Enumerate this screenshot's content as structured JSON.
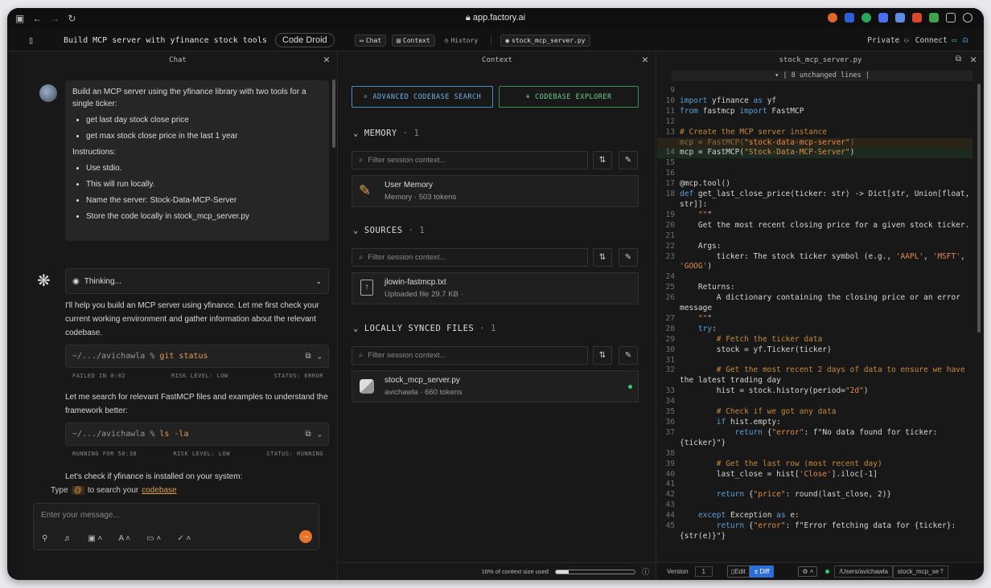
{
  "browser": {
    "url": "app.factory.ai"
  },
  "topbar": {
    "session_title": "Build MCP server with yfinance stock tools",
    "droid_label": "Code Droid",
    "tabs": [
      "Chat",
      "Context",
      "History"
    ],
    "file_tab": "stock_mcp_server.py",
    "private_label": "Private",
    "connect_label": "Connect"
  },
  "chat": {
    "title": "Chat",
    "user_message": {
      "intro": "Build an MCP server using the yfinance library with two tools for a single ticker:",
      "bullets1": [
        "get last day stock close price",
        "get max stock close price in the last 1 year"
      ],
      "instructions_label": "Instructions:",
      "bullets2": [
        "Use stdio.",
        "This will run locally.",
        "Name the server: Stock-Data-MCP-Server",
        "Store the code locally in stock_mcp_server.py"
      ]
    },
    "thinking_label": "Thinking...",
    "para1": "I'll help you build an MCP server using yfinance. Let me first check your current working environment and gather information about the relevant codebase.",
    "term1": {
      "path": "~/.../avichawla",
      "prompt": "%",
      "cmd": "git status",
      "meta": [
        "FAILED IN 0:02",
        "RISK LEVEL: LOW",
        "STATUS: ERROR"
      ]
    },
    "para2": "Let me search for relevant FastMCP files and examples to understand the framework better:",
    "term2": {
      "path": "~/.../avichawla",
      "prompt": "%",
      "cmd": "ls -la",
      "meta": [
        "RUNNING FOR 58:38",
        "RISK LEVEL: LOW",
        "STATUS: RUNNING"
      ]
    },
    "para3": "Let's check if yfinance is installed on your system:",
    "hint": {
      "prefix": "Type",
      "at": "@",
      "middle": "to search your",
      "link": "codebase"
    },
    "input_placeholder": "Enter your message..."
  },
  "context": {
    "title": "Context",
    "btn_search": "ADVANCED CODEBASE SEARCH",
    "btn_explorer": "CODEBASE EXPLORER",
    "filter_placeholder": "Filter session context...",
    "sections": [
      {
        "name": "MEMORY",
        "count": "1",
        "item": {
          "title": "User Memory",
          "sub": "Memory · 503 tokens"
        }
      },
      {
        "name": "SOURCES",
        "count": "1",
        "item": {
          "title": "jlowin-fastmcp.txt",
          "sub": "Uploaded file 29.7 KB ·"
        }
      },
      {
        "name": "LOCALLY SYNCED FILES",
        "count": "1",
        "item": {
          "title": "stock_mcp_server.py",
          "sub": "avichawla · 660 tokens"
        }
      }
    ],
    "usage": "16% of context size used",
    "usage_fraction": 0.16
  },
  "editor": {
    "title": "stock_mcp_server.py",
    "unchanged": "8 unchanged lines",
    "version_label": "Version",
    "version_value": "1",
    "edit_label": "Edit",
    "diff_label": "± Diff",
    "path": "/Users/avichawla",
    "file_chip": "stock_mcp_se"
  },
  "code_lines": [
    {
      "n": "9",
      "t": ""
    },
    {
      "n": "10",
      "t": "import yfinance as yf"
    },
    {
      "n": "11",
      "t": "from fastmcp import FastMCP"
    },
    {
      "n": "12",
      "t": ""
    },
    {
      "n": "13",
      "t": "# Create the MCP server instance"
    },
    {
      "n": "",
      "t": "mcp = FastMCP(\"stock-data-mcp-server\")"
    },
    {
      "n": "14",
      "t": "mcp = FastMCP(\"Stock-Data-MCP-Server\")"
    },
    {
      "n": "15",
      "t": ""
    },
    {
      "n": "16",
      "t": ""
    },
    {
      "n": "17",
      "t": "@mcp.tool()"
    },
    {
      "n": "18",
      "t": "def get_last_close_price(ticker: str) -> Dict[str, Union[float,"
    },
    {
      "n": "",
      "t": "str]]:"
    },
    {
      "n": "19",
      "t": "    \"\"\""
    },
    {
      "n": "20",
      "t": "    Get the most recent closing price for a given stock ticker."
    },
    {
      "n": "21",
      "t": ""
    },
    {
      "n": "22",
      "t": "    Args:"
    },
    {
      "n": "23",
      "t": "        ticker: The stock ticker symbol (e.g., 'AAPL', 'MSFT',"
    },
    {
      "n": "",
      "t": "'GOOG')"
    },
    {
      "n": "24",
      "t": ""
    },
    {
      "n": "25",
      "t": "    Returns:"
    },
    {
      "n": "26",
      "t": "        A dictionary containing the closing price or an error"
    },
    {
      "n": "",
      "t": "message"
    },
    {
      "n": "27",
      "t": "    \"\"\""
    },
    {
      "n": "28",
      "t": "    try:"
    },
    {
      "n": "29",
      "t": "        # Fetch the ticker data"
    },
    {
      "n": "30",
      "t": "        stock = yf.Ticker(ticker)"
    },
    {
      "n": "31",
      "t": ""
    },
    {
      "n": "32",
      "t": "        # Get the most recent 2 days of data to ensure we have"
    },
    {
      "n": "",
      "t": "the latest trading day"
    },
    {
      "n": "33",
      "t": "        hist = stock.history(period=\"2d\")"
    },
    {
      "n": "34",
      "t": ""
    },
    {
      "n": "35",
      "t": "        # Check if we got any data"
    },
    {
      "n": "36",
      "t": "        if hist.empty:"
    },
    {
      "n": "37",
      "t": "            return {\"error\": f\"No data found for ticker:"
    },
    {
      "n": "",
      "t": "{ticker}\"}"
    },
    {
      "n": "38",
      "t": ""
    },
    {
      "n": "39",
      "t": "        # Get the last row (most recent day)"
    },
    {
      "n": "40",
      "t": "        last_close = hist['Close'].iloc[-1]"
    },
    {
      "n": "41",
      "t": ""
    },
    {
      "n": "42",
      "t": "        return {\"price\": round(last_close, 2)}"
    },
    {
      "n": "43",
      "t": ""
    },
    {
      "n": "44",
      "t": "    except Exception as e:"
    },
    {
      "n": "45",
      "t": "        return {\"error\": f\"Error fetching data for {ticker}:"
    },
    {
      "n": "",
      "t": "{str(e)}\"}"
    }
  ]
}
